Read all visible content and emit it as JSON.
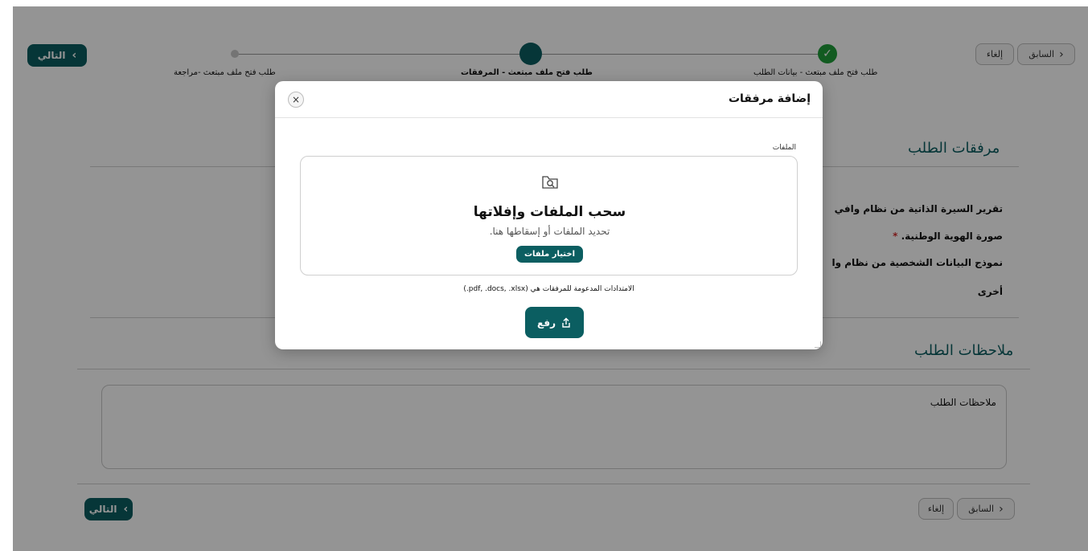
{
  "header": {
    "next_label": "التالي",
    "prev_label": "السابق",
    "cancel_label": "إلغاء"
  },
  "stepper": {
    "steps": [
      {
        "label": "طلب فتح ملف مبتعث - بيانات الطلب",
        "state": "done"
      },
      {
        "label": "طلب فتح ملف مبتعث - المرفقات",
        "state": "current"
      },
      {
        "label": "طلب فتح ملف مبتعث -مراجعة",
        "state": "pending"
      }
    ]
  },
  "attachments": {
    "title": "مرفقات الطلب",
    "items": [
      {
        "label": "تقرير السيرة الذاتية من نظام وافي",
        "required": false
      },
      {
        "label": "صورة الهوية الوطنية.",
        "required": true
      },
      {
        "label": "نموذج البيانات الشخصية من نظام وا",
        "required": false
      },
      {
        "label": "أخرى",
        "required": false
      }
    ],
    "required_mark": "*"
  },
  "notes": {
    "title": "ملاحظات الطلب",
    "field_label": "ملاحظات الطلب"
  },
  "footer": {
    "next_label": "التالي",
    "prev_label": "السابق",
    "cancel_label": "إلغاء"
  },
  "modal": {
    "title": "إضافة مرفقات",
    "close_glyph": "×",
    "files_label": "الملفات",
    "dropzone": {
      "icon": "folder-search-icon",
      "title": "سحب الملفات وإفلاتها",
      "subtitle": "تحديد الملفات أو إسقاطها هنا.",
      "choose_label": "اختيار ملفات"
    },
    "extensions_note": "الامتدادات المدعومة للمرفقات هي (pdf, .docs, .xlsx.)",
    "upload_label": "رفع",
    "upload_icon": "upload-icon"
  },
  "colors": {
    "primary": "#0b5e61",
    "success": "#1f9d3a",
    "required": "#d32f2f"
  }
}
